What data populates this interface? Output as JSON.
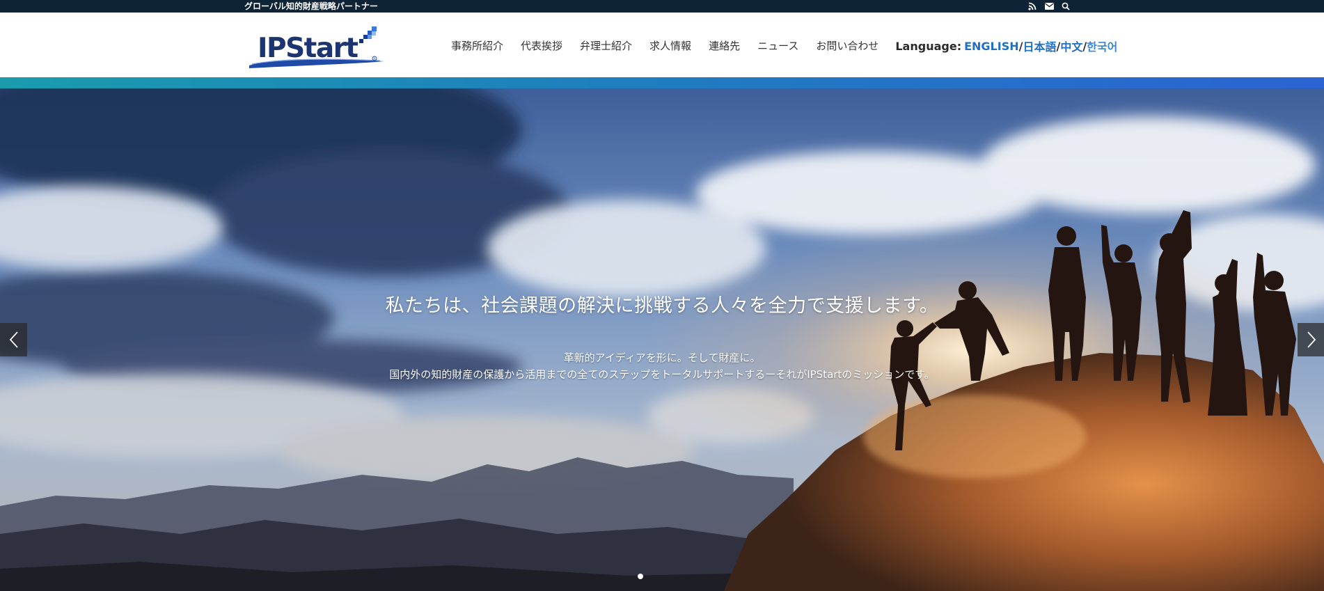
{
  "topbar": {
    "tagline": "グローバル知的財産戦略パートナー",
    "icons": [
      "rss-icon",
      "mail-icon",
      "search-icon"
    ]
  },
  "header": {
    "logo_text": "IPStart",
    "nav": [
      {
        "label": "事務所紹介"
      },
      {
        "label": "代表挨拶"
      },
      {
        "label": "弁理士紹介"
      },
      {
        "label": "求人情報"
      },
      {
        "label": "連絡先"
      },
      {
        "label": "ニュース"
      },
      {
        "label": "お問い合わせ"
      }
    ],
    "language": {
      "label": "Language:",
      "options": [
        "ENGLISH",
        "日本語",
        "中文",
        "한국어"
      ],
      "separator": "/"
    }
  },
  "hero": {
    "headline": "私たちは、社会課題の解決に挑戦する人々を全力で支援します。",
    "sub_line1": "革新的アイディアを形に。そして財産に。",
    "sub_line2": "国内外の知的財産の保護から活用までの全てのステップをトータルサポートするーそれがIPStartのミッションです。",
    "prev_icon": "chevron-left-icon",
    "next_icon": "chevron-right-icon",
    "slide_count": 1,
    "active_slide": 1
  },
  "colors": {
    "topbar": "#0e2436",
    "link": "#1f6fc2",
    "band_start": "#1a9cad",
    "band_end": "#2b63d2"
  }
}
